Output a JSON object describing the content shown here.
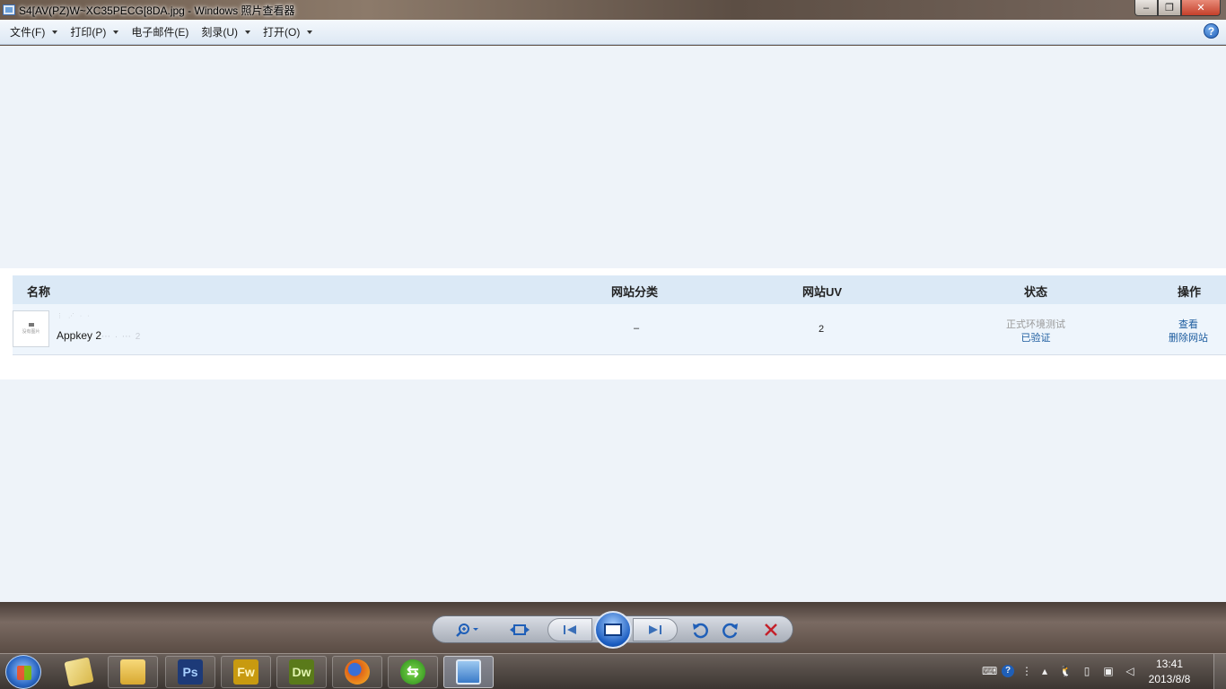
{
  "window": {
    "title": "S4[AV(PZ)W~XC35PECG[8DA.jpg - Windows 照片查看器",
    "controls": {
      "minimize": "‒",
      "maximize": "❐",
      "close": "✕"
    }
  },
  "menu": {
    "items": [
      {
        "label": "文件(F)",
        "has_dropdown": true
      },
      {
        "label": "打印(P)",
        "has_dropdown": true
      },
      {
        "label": "电子邮件(E)",
        "has_dropdown": false
      },
      {
        "label": "刻录(U)",
        "has_dropdown": true
      },
      {
        "label": "打开(O)",
        "has_dropdown": true
      }
    ],
    "help": "?"
  },
  "photo": {
    "table": {
      "headers": [
        "名称",
        "网站分类",
        "网站UV",
        "状态",
        "操作"
      ],
      "row": {
        "thumbnail_text": "没有图片",
        "site_name": "⋮ ⋰ · ·",
        "appkey_label": "Appkey 2",
        "appkey_value": "⋯ · ⋯ 2",
        "category": "–",
        "uv": "2",
        "status_line1": "正式环境测试",
        "status_line2": "已验证",
        "action_view": "查看",
        "action_delete": "删除网站"
      }
    }
  },
  "viewer_controls": {
    "zoom_icon": "zoom-icon",
    "fit_icon": "actual-size-icon",
    "prev_icon": "previous-icon",
    "slideshow_icon": "slideshow-icon",
    "next_icon": "next-icon",
    "rotate_ccw_icon": "rotate-counterclockwise-icon",
    "rotate_cw_icon": "rotate-clockwise-icon",
    "delete_icon": "delete-icon"
  },
  "taskbar": {
    "apps": [
      {
        "name": "windows-explorer-libraries",
        "label": ""
      },
      {
        "name": "file-explorer",
        "label": ""
      },
      {
        "name": "photoshop",
        "label": "Ps",
        "color": "#1d3a78"
      },
      {
        "name": "fireworks",
        "label": "Fw",
        "color": "#c89a10"
      },
      {
        "name": "dreamweaver",
        "label": "Dw",
        "color": "#5a7a1a"
      },
      {
        "name": "firefox",
        "label": "",
        "color": "#e0641a"
      },
      {
        "name": "green-app",
        "label": "",
        "color": "#3aa82a"
      },
      {
        "name": "photo-viewer",
        "label": "",
        "color": "#3a7ac8"
      }
    ],
    "clock_time": "13:41",
    "clock_date": "2013/8/8"
  }
}
